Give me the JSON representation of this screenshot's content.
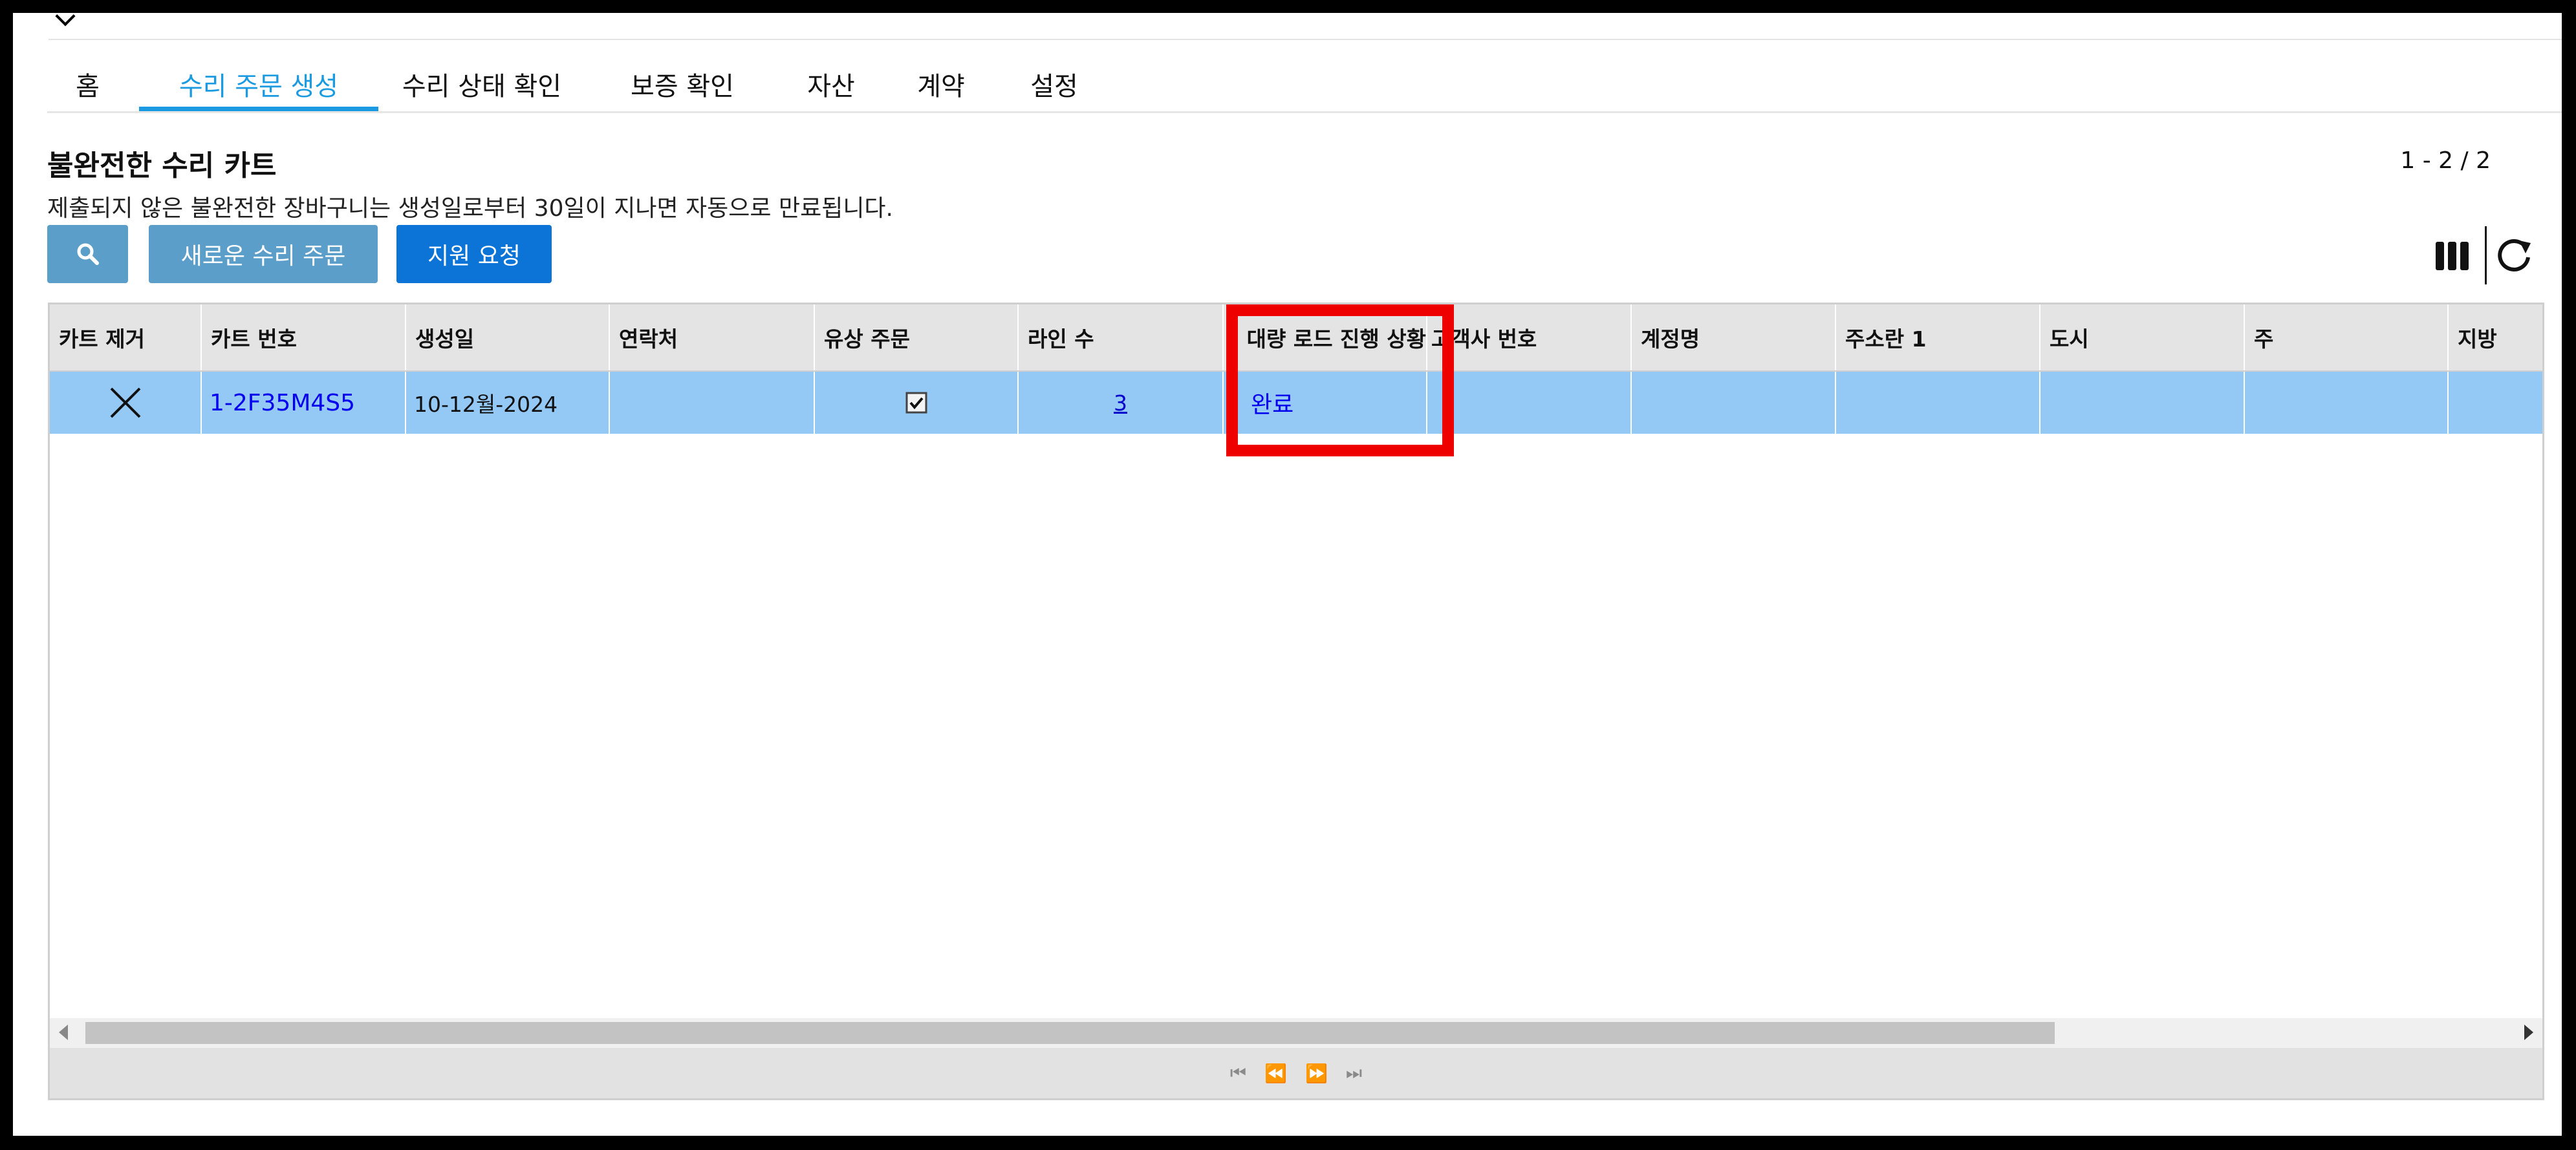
{
  "tabs": [
    {
      "label": "홈",
      "active": false
    },
    {
      "label": "수리 주문 생성",
      "active": true
    },
    {
      "label": "수리 상태 확인",
      "active": false
    },
    {
      "label": "보증 확인",
      "active": false
    },
    {
      "label": "자산",
      "active": false
    },
    {
      "label": "계약",
      "active": false
    },
    {
      "label": "설정",
      "active": false
    }
  ],
  "section": {
    "title": "불완전한 수리 카트",
    "description": "제출되지 않은 불완전한 장바구니는 생성일로부터 30일이 지나면 자동으로 만료됩니다.",
    "record_count": "1 - 2 / 2"
  },
  "toolbar": {
    "search_icon": "search-icon",
    "new_order_label": "새로운 수리 주문",
    "support_label": "지원 요청",
    "columns_icon": "columns-icon",
    "refresh_icon": "refresh-icon"
  },
  "grid": {
    "columns": [
      "카트 제거",
      "카트 번호",
      "생성일",
      "연락처",
      "유상 주문",
      "라인 수",
      "대량 로드 진행 상황",
      "고객사 번호",
      "계정명",
      "주소란 1",
      "도시",
      "주",
      "지방"
    ],
    "rows": [
      {
        "remove_icon": "close-icon",
        "cart_number": "1-2F35M4S5",
        "created": "10-12월-2024",
        "contact": "",
        "paid_order_checked": true,
        "line_count": "3",
        "bulk_status": "완료",
        "customer_number": "",
        "account_name": "",
        "address1": "",
        "city": "",
        "state": "",
        "province": ""
      }
    ]
  },
  "colors": {
    "active_tab": "#1a9ae0",
    "selected_row": "#94c8f5",
    "highlight": "#ee0000",
    "primary_button": "#0b74d6",
    "secondary_button": "#5b9ec9"
  }
}
